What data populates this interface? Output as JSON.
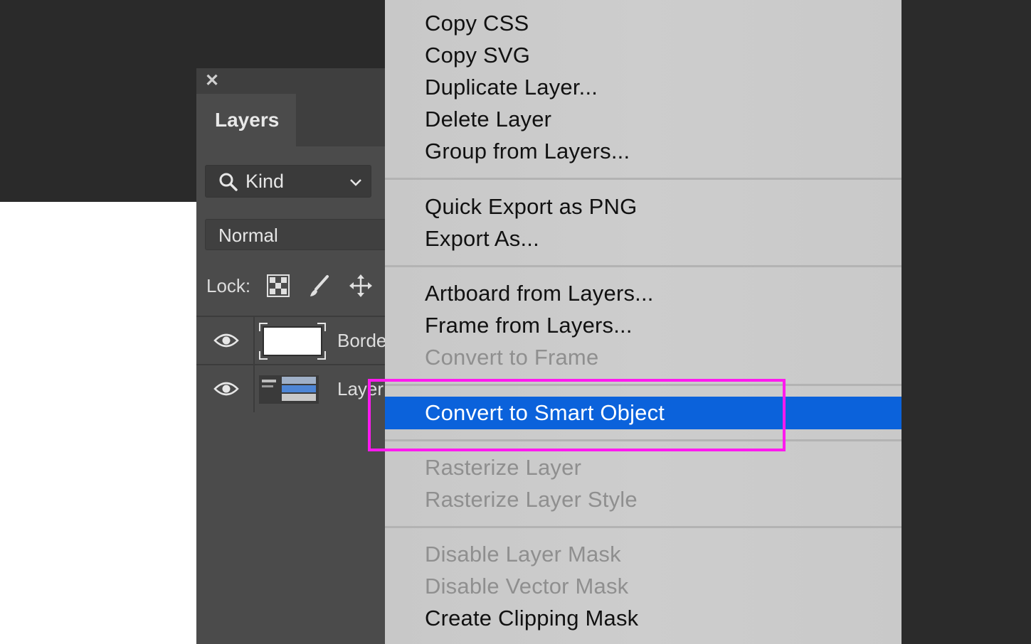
{
  "panel": {
    "close_icon": "close-icon",
    "tab_label": "Layers",
    "filter_value": "Kind",
    "blend_mode": "Normal",
    "lock_label": "Lock:",
    "layers": [
      {
        "name": "Borde",
        "visible": true
      },
      {
        "name": "Layer",
        "visible": true
      }
    ]
  },
  "menu": {
    "groups": [
      [
        "Copy CSS",
        "Copy SVG",
        "Duplicate Layer...",
        "Delete Layer",
        "Group from Layers..."
      ],
      [
        "Quick Export as PNG",
        "Export As..."
      ],
      [
        "Artboard from Layers...",
        "Frame from Layers...",
        "Convert to Frame"
      ],
      [
        "Convert to Smart Object"
      ],
      [
        "Rasterize Layer",
        "Rasterize Layer Style"
      ],
      [
        "Disable Layer Mask",
        "Disable Vector Mask",
        "Create Clipping Mask"
      ]
    ],
    "items": {
      "copy_css": "Copy CSS",
      "copy_svg": "Copy SVG",
      "duplicate_layer": "Duplicate Layer...",
      "delete_layer": "Delete Layer",
      "group_from_layers": "Group from Layers...",
      "quick_export_png": "Quick Export as PNG",
      "export_as": "Export As...",
      "artboard_from_layers": "Artboard from Layers...",
      "frame_from_layers": "Frame from Layers...",
      "convert_to_frame": "Convert to Frame",
      "convert_to_smart_object": "Convert to Smart Object",
      "rasterize_layer": "Rasterize Layer",
      "rasterize_layer_style": "Rasterize Layer Style",
      "disable_layer_mask": "Disable Layer Mask",
      "disable_vector_mask": "Disable Vector Mask",
      "create_clipping_mask": "Create Clipping Mask"
    },
    "disabled": [
      "Convert to Frame",
      "Rasterize Layer",
      "Rasterize Layer Style",
      "Disable Layer Mask",
      "Disable Vector Mask"
    ],
    "highlighted": "Convert to Smart Object"
  },
  "colors": {
    "highlight": "#0b62db",
    "annotation": "#ff1aef",
    "panel_bg": "#4b4b4b",
    "menu_bg": "#cbcbcb"
  }
}
